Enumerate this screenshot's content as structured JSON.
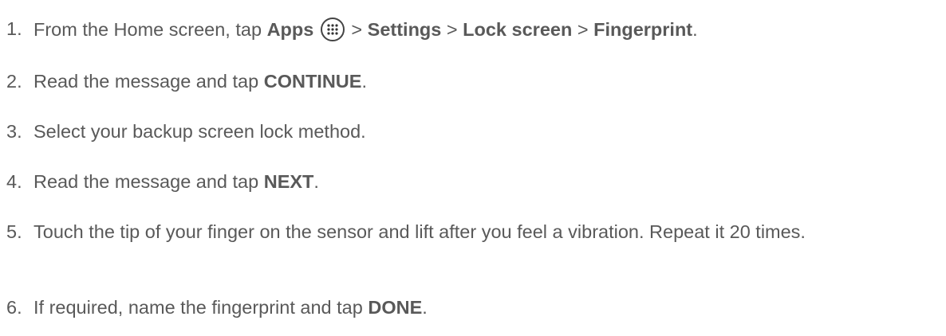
{
  "steps": [
    {
      "num": "1.",
      "parts": [
        {
          "text": "From the Home screen, tap ",
          "bold": false
        },
        {
          "text": "Apps",
          "bold": true
        },
        {
          "icon": "apps-grid-icon"
        },
        {
          "text": " > ",
          "bold": false
        },
        {
          "text": "Settings",
          "bold": true
        },
        {
          "text": " > ",
          "bold": false
        },
        {
          "text": "Lock screen",
          "bold": true
        },
        {
          "text": " > ",
          "bold": false
        },
        {
          "text": "Fingerprint",
          "bold": true
        },
        {
          "text": ".",
          "bold": false
        }
      ]
    },
    {
      "num": "2.",
      "parts": [
        {
          "text": "Read the message and tap ",
          "bold": false
        },
        {
          "text": "CONTINUE",
          "bold": true
        },
        {
          "text": ".",
          "bold": false
        }
      ]
    },
    {
      "num": "3.",
      "parts": [
        {
          "text": "Select your backup screen lock method.",
          "bold": false
        }
      ]
    },
    {
      "num": "4.",
      "parts": [
        {
          "text": "Read the message and tap ",
          "bold": false
        },
        {
          "text": "NEXT",
          "bold": true
        },
        {
          "text": ".",
          "bold": false
        }
      ]
    },
    {
      "num": "5.",
      "parts": [
        {
          "text": "Touch the tip of your finger on the sensor and lift after you feel a vibration. Repeat it 20 times.",
          "bold": false
        }
      ]
    },
    {
      "num": "6.",
      "parts": [
        {
          "text": "If required, name the fingerprint and tap ",
          "bold": false
        },
        {
          "text": "DONE",
          "bold": true
        },
        {
          "text": ".",
          "bold": false
        }
      ]
    }
  ]
}
